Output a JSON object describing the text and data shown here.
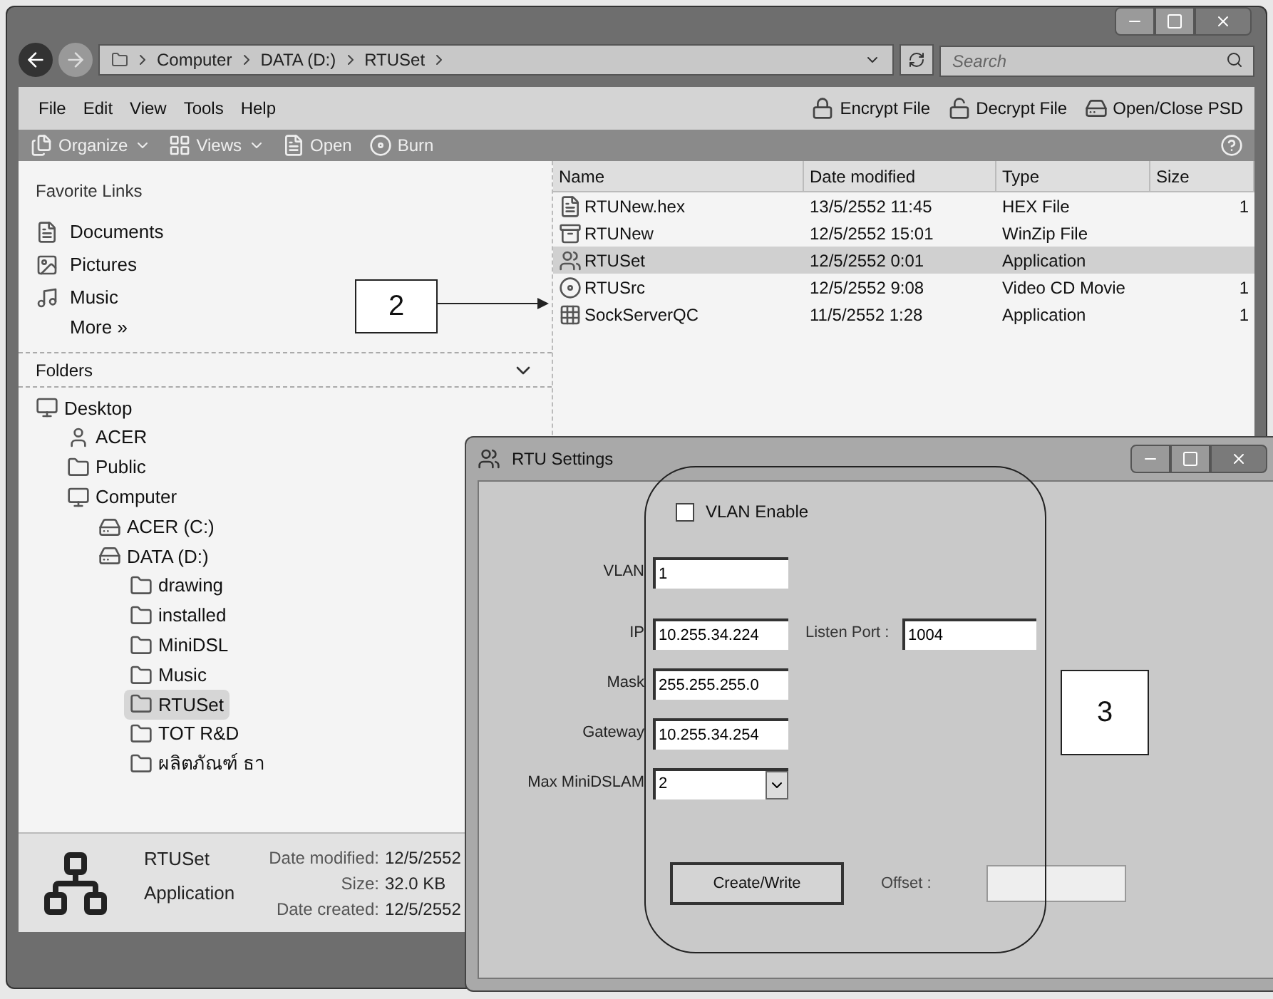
{
  "explorer": {
    "address_path": [
      "Computer",
      "DATA (D:)",
      "RTUSet"
    ],
    "search": {
      "placeholder": "Search"
    },
    "menu": [
      "File",
      "Edit",
      "View",
      "Tools",
      "Help"
    ],
    "commands": [
      {
        "label": "Encrypt File",
        "kind": "encrypt"
      },
      {
        "label": "Decrypt File",
        "kind": "decrypt"
      },
      {
        "label": "Open/Close PSD",
        "kind": "drive"
      }
    ],
    "toolbar": [
      {
        "label": "Organize",
        "kind": "organize",
        "dropdown": true
      },
      {
        "label": "Views",
        "kind": "views",
        "dropdown": true
      },
      {
        "label": "Open",
        "kind": "open",
        "dropdown": false
      },
      {
        "label": "Burn",
        "kind": "burn",
        "dropdown": false
      }
    ],
    "favorites": {
      "title": "Favorite Links",
      "items": [
        {
          "label": "Documents",
          "kind": "documents"
        },
        {
          "label": "Pictures",
          "kind": "pictures"
        },
        {
          "label": "Music",
          "kind": "music"
        }
      ],
      "more": "More »"
    },
    "folders": {
      "title": "Folders",
      "tree": [
        {
          "label": "Desktop",
          "kind": "desktop",
          "selected": false,
          "children": [
            {
              "label": "ACER",
              "kind": "user",
              "selected": false
            },
            {
              "label": "Public",
              "kind": "folder",
              "selected": false
            },
            {
              "label": "Computer",
              "kind": "computer",
              "selected": false,
              "children": [
                {
                  "label": "ACER (C:)",
                  "kind": "drive",
                  "selected": false
                },
                {
                  "label": "DATA (D:)",
                  "kind": "drive",
                  "selected": false,
                  "children": [
                    {
                      "label": "drawing",
                      "kind": "folder",
                      "selected": false
                    },
                    {
                      "label": "installed",
                      "kind": "folder",
                      "selected": false
                    },
                    {
                      "label": "MiniDSL",
                      "kind": "folder",
                      "selected": false
                    },
                    {
                      "label": "Music",
                      "kind": "folder",
                      "selected": false
                    },
                    {
                      "label": "RTUSet",
                      "kind": "folder",
                      "selected": true
                    },
                    {
                      "label": "TOT R&D",
                      "kind": "folder",
                      "selected": false
                    },
                    {
                      "label": "ผลิตภัณฑ์ ธา",
                      "kind": "folder",
                      "selected": false
                    }
                  ]
                }
              ]
            }
          ]
        }
      ]
    },
    "table": {
      "columns": [
        "Name",
        "Date modified",
        "Type",
        "Size"
      ],
      "rows": [
        {
          "name": "RTUNew.hex",
          "kind": "file",
          "date": "13/5/2552 11:45",
          "type": "HEX File",
          "size": "1",
          "selected": false
        },
        {
          "name": "RTUNew",
          "kind": "zip",
          "date": "12/5/2552 15:01",
          "type": "WinZip File",
          "selected": false
        },
        {
          "name": "RTUSet",
          "kind": "app",
          "date": "12/5/2552 0:01",
          "type": "Application",
          "selected": true
        },
        {
          "name": "RTUSrc",
          "kind": "disc",
          "date": "12/5/2552 9:08",
          "type": "Video CD Movie",
          "size": "1",
          "selected": false
        },
        {
          "name": "SockServerQC",
          "kind": "grid",
          "date": "11/5/2552 1:28",
          "type": "Application",
          "size": "1",
          "selected": false
        }
      ]
    },
    "details": {
      "name": "RTUSet",
      "type": "Application",
      "fields": [
        {
          "label": "Date modified:",
          "value": "12/5/2552"
        },
        {
          "label": "Size:",
          "value": "32.0 KB"
        },
        {
          "label": "Date created:",
          "value": "12/5/2552"
        }
      ]
    }
  },
  "dialog": {
    "title": "RTU Settings",
    "vlan_enable": {
      "label": "VLAN Enable",
      "checked": false
    },
    "fields": [
      {
        "label": "VLAN",
        "value": "1",
        "kind": "text"
      },
      {
        "label": "IP",
        "value": "10.255.34.224",
        "kind": "text"
      },
      {
        "label": "Mask",
        "value": "255.255.255.0",
        "kind": "text"
      },
      {
        "label": "Gateway",
        "value": "10.255.34.254",
        "kind": "text"
      },
      {
        "label": "Max MiniDSLAM",
        "value": "2",
        "kind": "select"
      }
    ],
    "listen_port": {
      "label": "Listen Port :",
      "value": "1004"
    },
    "button": "Create/Write",
    "offset": {
      "label": "Offset :"
    }
  },
  "annotations": [
    {
      "label": "2"
    },
    {
      "label": "3"
    }
  ]
}
